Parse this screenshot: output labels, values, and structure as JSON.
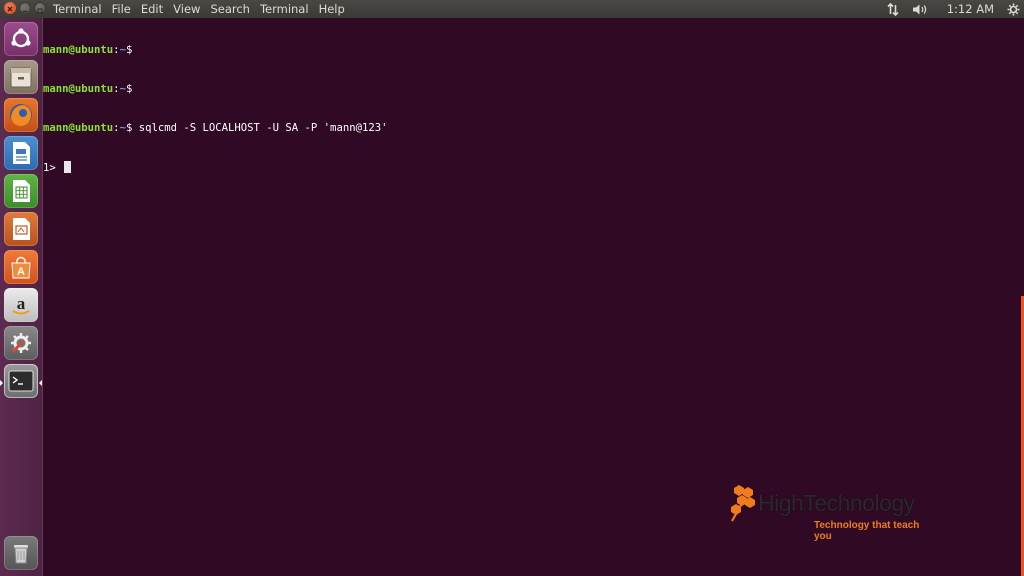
{
  "topbar": {
    "app_name": "Terminal",
    "menu": [
      "File",
      "Edit",
      "View",
      "Search",
      "Terminal",
      "Help"
    ],
    "clock": "1:12 AM"
  },
  "launcher": {
    "items": [
      "ubuntu-dash",
      "files",
      "firefox",
      "libreoffice-writer",
      "libreoffice-calc",
      "libreoffice-impress",
      "ubuntu-software",
      "amazon",
      "system-settings",
      "terminal",
      "trash"
    ]
  },
  "terminal": {
    "lines": [
      {
        "user": "mann@ubuntu",
        "path": "~",
        "suffix": "$",
        "command": ""
      },
      {
        "user": "mann@ubuntu",
        "path": "~",
        "suffix": "$",
        "command": ""
      },
      {
        "user": "mann@ubuntu",
        "path": "~",
        "suffix": "$",
        "command": " sqlcmd -S LOCALHOST -U SA -P 'mann@123'"
      }
    ],
    "prompt": "1> "
  },
  "watermark": {
    "title": "HighTechnology",
    "subtitle": "Technology that teach you"
  },
  "colors": {
    "terminal_bg": "#300a24",
    "user_green": "#8ae234",
    "path_blue": "#729fcf",
    "accent_orange": "#e95420"
  }
}
